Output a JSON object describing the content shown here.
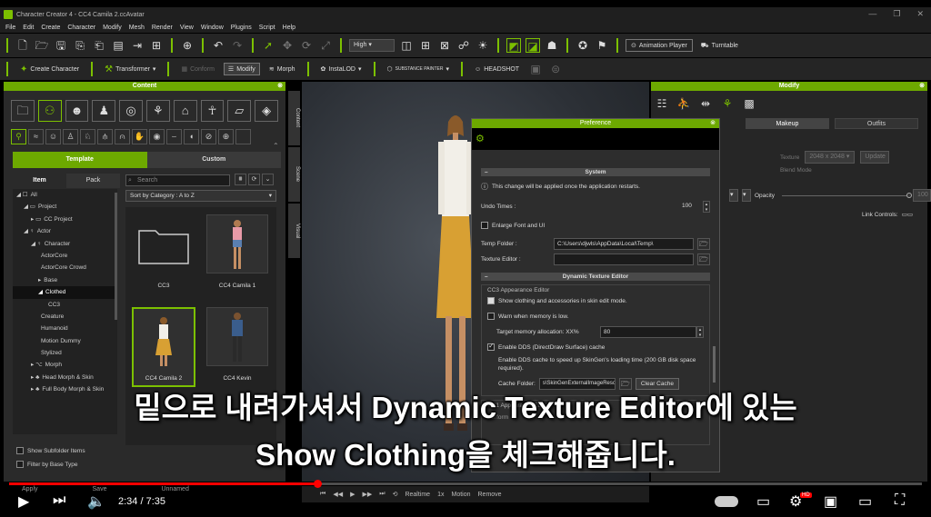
{
  "window": {
    "title": "Character Creator 4 - CC4 Camila 2.ccAvatar",
    "controls": [
      "—",
      "❐",
      "✕"
    ]
  },
  "menu": [
    "File",
    "Edit",
    "Create",
    "Character",
    "Modify",
    "Mesh",
    "Render",
    "View",
    "Window",
    "Plugins",
    "Script",
    "Help"
  ],
  "toolbar1": {
    "quality": "High",
    "animation_player": "Animation Player",
    "turntable": "Turntable"
  },
  "toolbar2": {
    "create_character": "Create Character",
    "transformer": "Transformer",
    "conform": "Conform",
    "modify": "Modify",
    "morph": "Morph",
    "insta_lod": "InstaLOD",
    "substance": "SUBSTANCE PAINTER",
    "headshot": "HEADSHOT"
  },
  "content_panel": {
    "title": "Content",
    "tab_template": "Template",
    "tab_custom": "Custom",
    "subtab_item": "Item",
    "subtab_pack": "Pack",
    "search_placeholder": "Search",
    "sort": "Sort by Category : A to Z",
    "tree": [
      {
        "label": "All",
        "indent": 0,
        "prefix": "◢ ☐"
      },
      {
        "label": "Project",
        "indent": 1,
        "prefix": "◢ ▭"
      },
      {
        "label": "CC Project",
        "indent": 2,
        "prefix": "▸ ▭"
      },
      {
        "label": "Actor",
        "indent": 1,
        "prefix": "◢ ♀"
      },
      {
        "label": "Character",
        "indent": 2,
        "prefix": "◢ ♀"
      },
      {
        "label": "ActorCore",
        "indent": 3,
        "prefix": ""
      },
      {
        "label": "ActorCore Crowd",
        "indent": 3,
        "prefix": ""
      },
      {
        "label": "Base",
        "indent": 3,
        "prefix": "▸"
      },
      {
        "label": "Clothed",
        "indent": 3,
        "prefix": "◢",
        "selected": true
      },
      {
        "label": "CC3",
        "indent": 4,
        "prefix": ""
      },
      {
        "label": "Creature",
        "indent": 3,
        "prefix": ""
      },
      {
        "label": "Humanoid",
        "indent": 3,
        "prefix": ""
      },
      {
        "label": "Motion Dummy",
        "indent": 3,
        "prefix": ""
      },
      {
        "label": "Stylized",
        "indent": 3,
        "prefix": ""
      },
      {
        "label": "Morph",
        "indent": 2,
        "prefix": "▸ ⌥"
      },
      {
        "label": "Head Morph & Skin",
        "indent": 2,
        "prefix": "▸ ♣"
      },
      {
        "label": "Full Body Morph & Skin",
        "indent": 2,
        "prefix": "▸ ♣"
      }
    ],
    "thumbnails": [
      {
        "label": "CC3",
        "kind": "folder"
      },
      {
        "label": "CC4 Camila 1",
        "kind": "camila1"
      },
      {
        "label": "CC4 Camila 2",
        "kind": "camila2",
        "selected": true
      },
      {
        "label": "CC4 Kevin",
        "kind": "kevin"
      }
    ],
    "show_subfolder": "Show Subfolder Items",
    "filter_base": "Filter by Base Type",
    "apply": "Apply",
    "save": "Save",
    "unnamed": "Unnamed"
  },
  "side_tabs": [
    "Content",
    "Scene",
    "Visual"
  ],
  "modify_panel": {
    "title": "Modify",
    "tab_makeup": "Makeup",
    "tab_outfits": "Outfits",
    "texture_label": "Texture",
    "texture_size": "2048 x 2048",
    "update": "Update",
    "blend_mode": "Blend Mode",
    "opacity": "Opacity",
    "opacity_value": "100",
    "link_controls": "Link Controls:"
  },
  "preference": {
    "title": "Preference",
    "system_section": "System",
    "restart_note": "This change will be applied once the application restarts.",
    "undo_label": "Undo Times :",
    "undo_value": "100",
    "enlarge_font": "Enlarge Font and UI",
    "temp_folder_label": "Temp Folder :",
    "temp_folder_value": "C:\\Users\\djwls\\AppData\\Local\\Temp\\",
    "texture_editor_label": "Texture Editor :",
    "dte_section": "Dynamic Texture Editor",
    "cc3_group": "CC3 Appearance Editor",
    "show_clothing": "Show clothing and accessories in skin edit mode.",
    "warn_memory": "Warn when memory is low.",
    "target_memory_label": "Target memory allocation: XX%",
    "target_memory_value": "80",
    "enable_dds": "Enable DDS (DirectDraw Surface) cache",
    "dds_note": "Enable DDS cache to speed up SkinGen's loading time (200 GB disk space required).",
    "cache_folder_label": "Cache Folder:",
    "cache_folder_value": "s\\SkinGenExternalImageResource\\",
    "clear_cache": "Clear Cache",
    "cc1_group": "CC1 Appearance Editor",
    "perform": "Perform"
  },
  "subtitles": {
    "line1": "밑으로 내려가셔서 Dynamic Texture Editor에 있는",
    "line2": "Show Clothing을 체크해줍니다."
  },
  "player": {
    "time": "2:34 / 7:35",
    "progress": 0.338,
    "hd_badge": "HD"
  },
  "bottom_bar": {
    "realtime": "Realtime",
    "speed": "1x",
    "motion": "Motion",
    "remove": "Remove"
  },
  "colors": {
    "accent": "#7cc000",
    "panel_head": "#6da900",
    "progress_red": "#ff0000"
  }
}
